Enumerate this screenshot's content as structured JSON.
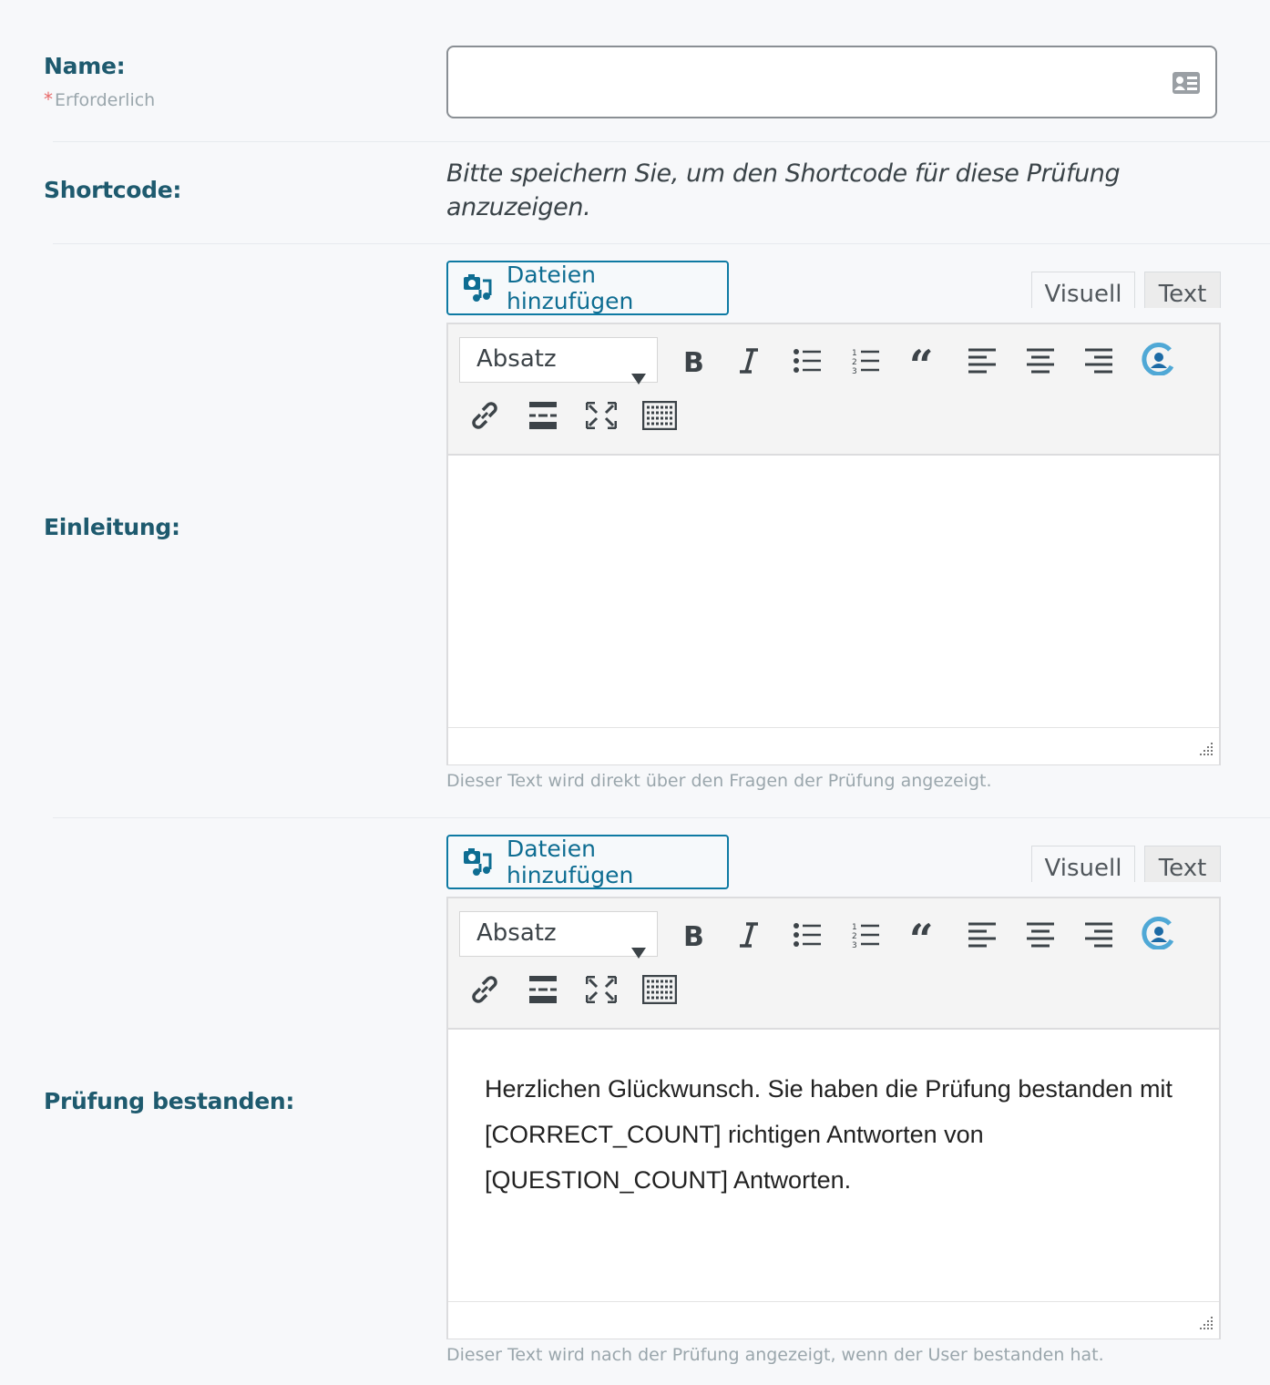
{
  "name_field": {
    "label": "Name:",
    "required": "Erforderlich",
    "value": "",
    "placeholder": ""
  },
  "shortcode": {
    "label": "Shortcode:",
    "note": "Bitte speichern Sie, um den Shortcode für diese Prüfung anzuzeigen."
  },
  "intro": {
    "label": "Einleitung:",
    "add_media": "Dateien hinzufügen",
    "tab_visual": "Visuell",
    "tab_text": "Text",
    "format": "Absatz",
    "content": "",
    "help": "Dieser Text wird direkt über den Fragen der Prüfung angezeigt."
  },
  "passed": {
    "label": "Prüfung bestanden:",
    "add_media": "Dateien hinzufügen",
    "tab_visual": "Visuell",
    "tab_text": "Text",
    "format": "Absatz",
    "content": "Herzlichen Glückwunsch. Sie haben die Prüfung bestanden mit [CORRECT_COUNT] richtigen Antworten von [QUESTION_COUNT] Antworten.",
    "help": "Dieser Text wird nach der Prüfung angezeigt, wenn der User bestanden hat."
  },
  "toolbar_icons": [
    "bold-icon",
    "italic-icon",
    "bullet-list-icon",
    "numbered-list-icon",
    "blockquote-icon",
    "align-left-icon",
    "align-center-icon",
    "align-right-icon",
    "plugin-icon",
    "link-icon",
    "read-more-icon",
    "fullscreen-icon",
    "toolbar-toggle-icon"
  ],
  "colors": {
    "label": "#1e5a6e",
    "accent": "#0e7aa3",
    "required_star": "#e86a6a",
    "muted": "#9aa6ac"
  }
}
